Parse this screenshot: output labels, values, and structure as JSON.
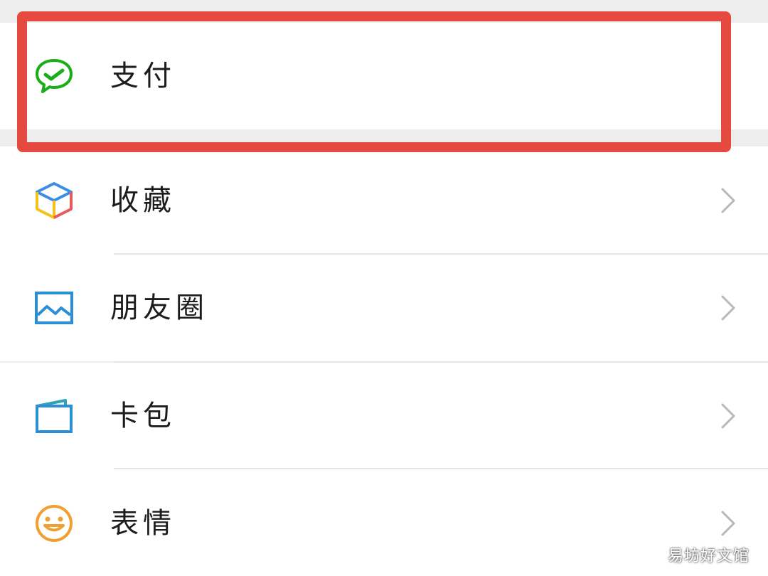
{
  "menu": {
    "items": [
      {
        "label": "支付",
        "icon": "wechat-pay-icon",
        "chevron": false
      },
      {
        "label": "收藏",
        "icon": "favorites-cube-icon",
        "chevron": true
      },
      {
        "label": "朋友圈",
        "icon": "moments-picture-icon",
        "chevron": true
      },
      {
        "label": "卡包",
        "icon": "card-wallet-icon",
        "chevron": true
      },
      {
        "label": "表情",
        "icon": "sticker-smiley-icon",
        "chevron": true
      }
    ]
  },
  "highlight": {
    "color": "#e6493f"
  },
  "watermark": {
    "text": "易坊好文馆"
  },
  "colors": {
    "pay_green": "#1aad19",
    "chevron": "#b8b8b8",
    "background": "#ededed"
  }
}
